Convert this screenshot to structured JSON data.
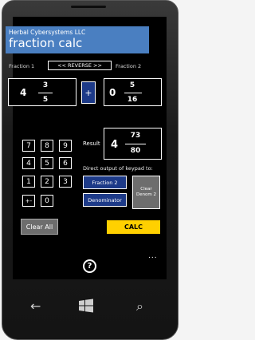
{
  "app": {
    "company": "Herbal Cybersystems LLC",
    "title": "fraction calc"
  },
  "labels": {
    "fraction1": "Fraction 1",
    "fraction2": "Fraction 2",
    "reverse": "<< REVERSE >>",
    "result": "Result",
    "direct_output": "Direct output of keypad to:"
  },
  "fraction1": {
    "whole": "4",
    "numerator": "3",
    "denominator": "5"
  },
  "operator": "+",
  "fraction2": {
    "whole": "0",
    "numerator": "5",
    "denominator": "16"
  },
  "result": {
    "whole": "4",
    "numerator": "73",
    "denominator": "80"
  },
  "keypad": {
    "row1": [
      "7",
      "8",
      "9"
    ],
    "row2": [
      "4",
      "5",
      "6"
    ],
    "row3": [
      "1",
      "2",
      "3"
    ],
    "sign": "+-",
    "zero": "0"
  },
  "targets": {
    "fraction2": "Fraction 2",
    "denominator": "Denominator",
    "clear_denom": "Clear Denom 2"
  },
  "buttons": {
    "clear_all": "Clear All",
    "calc": "CALC",
    "help": "?",
    "more": "..."
  },
  "hardware": {
    "back": "←",
    "search": "⌕"
  },
  "colors": {
    "banner": "#4a7fc1",
    "accent_blue": "#1d3a88",
    "calc_yellow": "#ffd000",
    "gray_button": "#6d6d6d"
  }
}
